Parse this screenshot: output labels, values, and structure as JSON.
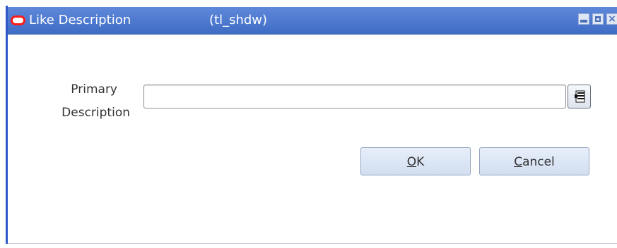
{
  "window": {
    "title": "Like Description",
    "identifier": "(tl_shdw)",
    "controls": [
      "minimize-icon",
      "maximize-icon",
      "close-icon"
    ]
  },
  "form": {
    "label_line_1": "Primary",
    "label_line_2": "Description",
    "input_value": "",
    "input_placeholder": ""
  },
  "buttons": {
    "ok_label": "OK",
    "ok_mnemonic": "O",
    "cancel_label": "Cancel",
    "cancel_mnemonic": "C"
  },
  "icons": {
    "logo": "oracle-logo-icon",
    "lov": "list-of-values-icon"
  },
  "colors": {
    "title_bar": "#4d79cf",
    "logo": "#ff1a1a",
    "button": "#d2def1"
  }
}
